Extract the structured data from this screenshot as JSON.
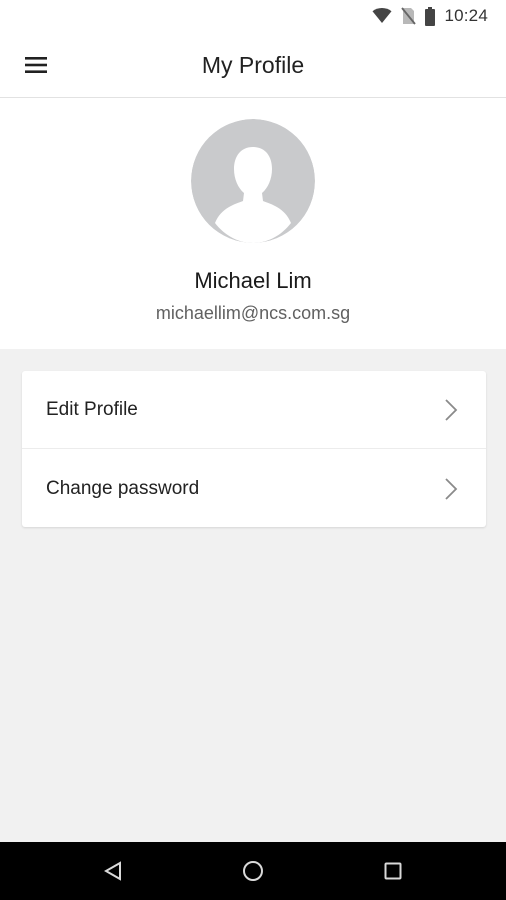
{
  "status_bar": {
    "time": "10:24",
    "icons": [
      "wifi-icon",
      "no-sim-icon",
      "battery-icon"
    ]
  },
  "app_bar": {
    "title": "My Profile",
    "menu_icon": "hamburger-menu-icon"
  },
  "profile": {
    "name": "Michael Lim",
    "email": "michaellim@ncs.com.sg",
    "avatar_icon": "default-avatar-icon"
  },
  "menu": {
    "items": [
      {
        "label": "Edit Profile",
        "icon": "chevron-right-icon"
      },
      {
        "label": "Change password",
        "icon": "chevron-right-icon"
      }
    ]
  },
  "nav_bar": {
    "buttons": [
      "back-icon",
      "home-icon",
      "recents-icon"
    ]
  },
  "colors": {
    "background": "#f1f1f1",
    "surface": "#ffffff",
    "avatar_bg": "#c9cacc",
    "nav_bar": "#000000"
  }
}
